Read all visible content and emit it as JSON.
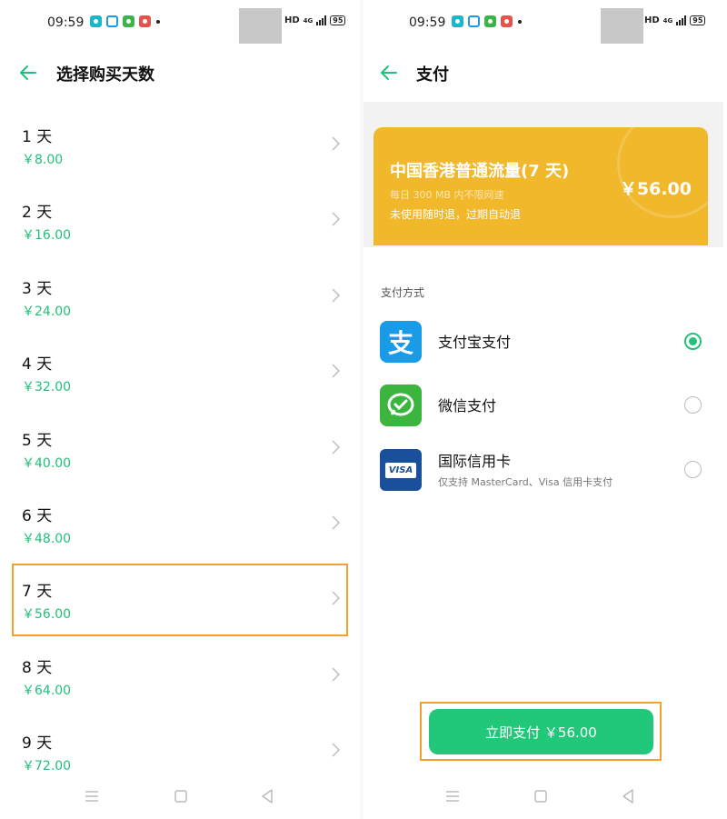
{
  "statusbar": {
    "time": "09:59",
    "network": "HD",
    "signal": "4G",
    "battery": "95"
  },
  "left_screen": {
    "title": "选择购买天数",
    "selected_index": 6,
    "days": [
      {
        "label": "1 天",
        "price": "￥8.00"
      },
      {
        "label": "2 天",
        "price": "￥16.00"
      },
      {
        "label": "3 天",
        "price": "￥24.00"
      },
      {
        "label": "4 天",
        "price": "￥32.00"
      },
      {
        "label": "5 天",
        "price": "￥40.00"
      },
      {
        "label": "6 天",
        "price": "￥48.00"
      },
      {
        "label": "7 天",
        "price": "￥56.00"
      },
      {
        "label": "8 天",
        "price": "￥64.00"
      },
      {
        "label": "9 天",
        "price": "￥72.00"
      }
    ]
  },
  "right_screen": {
    "title": "支付",
    "product": {
      "name": "中国香港普通流量(7 天)",
      "subtitle": "每日 300 MB 内不限网速",
      "note": "未使用随时退，过期自动退",
      "price": "￥56.00"
    },
    "payment_heading": "支付方式",
    "payment_methods": [
      {
        "name": "支付宝支付",
        "note": "",
        "icon": "alipay-icon",
        "icon_glyph": "支",
        "selected": true,
        "color": "#1a9be8"
      },
      {
        "name": "微信支付",
        "note": "",
        "icon": "wechat-pay-icon",
        "icon_glyph": "",
        "selected": false,
        "color": "#3bb53d"
      },
      {
        "name": "国际信用卡",
        "note": "仅支持 MasterCard、Visa 信用卡支付",
        "icon": "visa-card-icon",
        "icon_glyph": "VISA",
        "selected": false,
        "color": "#1a4f9c"
      }
    ],
    "pay_button": "立即支付 ￥56.00"
  },
  "colors": {
    "accent": "#22c07a",
    "highlight_border": "#f5a12d",
    "card": "#f0b82a"
  }
}
